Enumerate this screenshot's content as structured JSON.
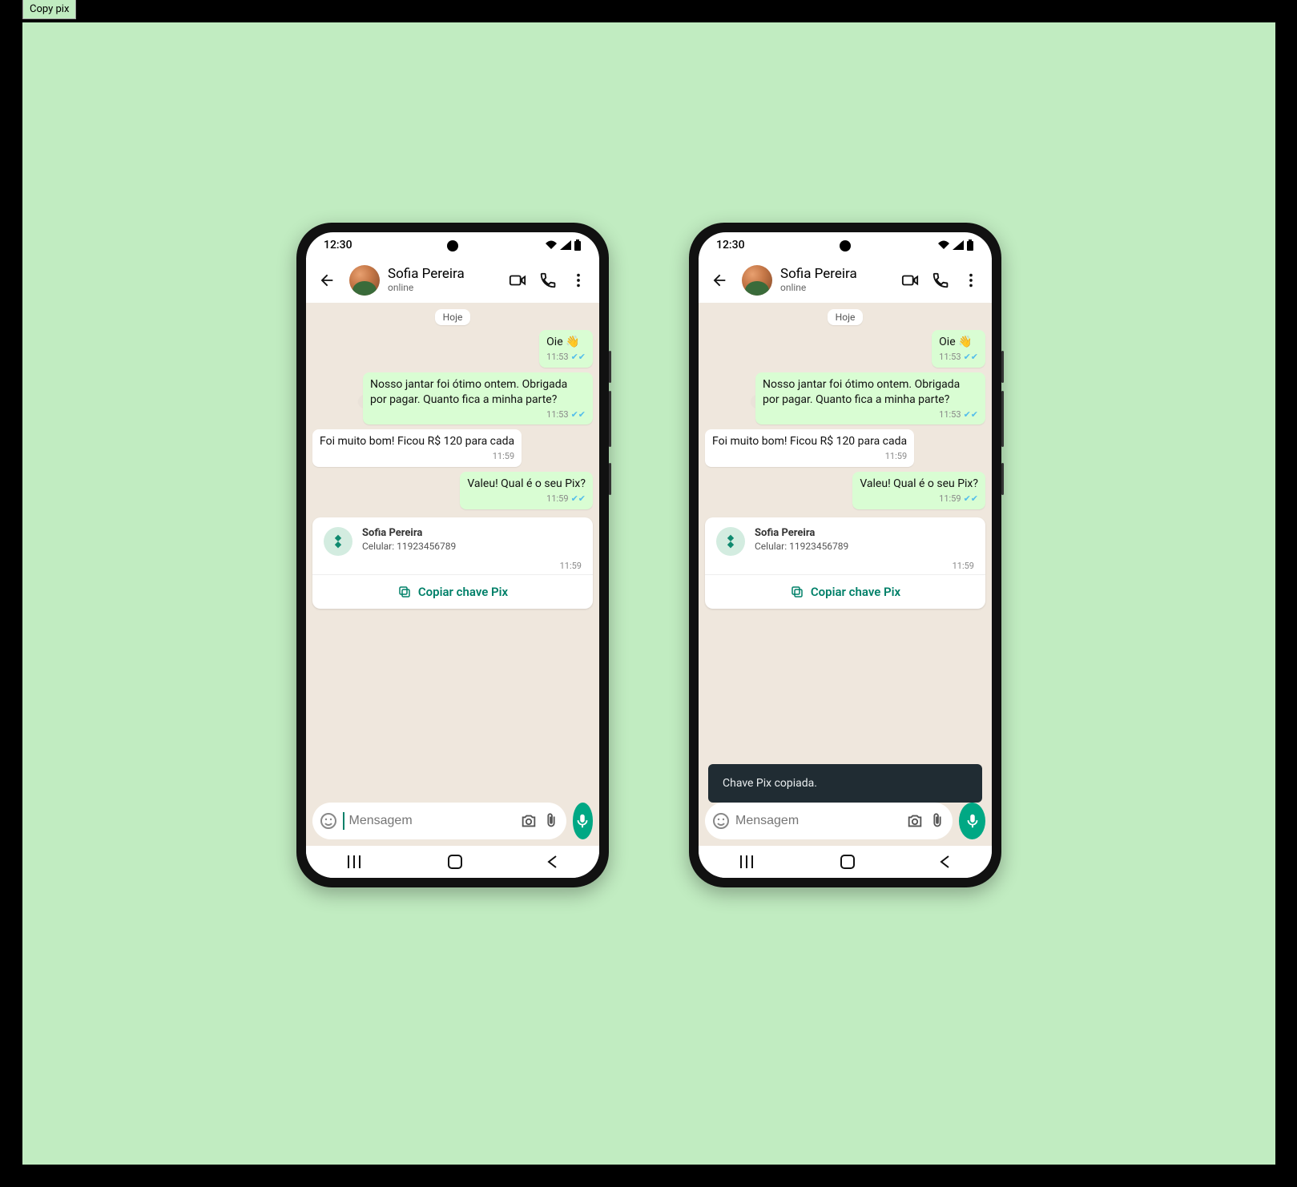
{
  "tab": {
    "label": "Copy pix"
  },
  "status": {
    "time": "12:30"
  },
  "header": {
    "contact_name": "Sofia Pereira",
    "presence": "online"
  },
  "chat": {
    "date_label": "Hoje",
    "messages": [
      {
        "side": "out",
        "text": "Oie 👋",
        "time": "11:53",
        "read": true
      },
      {
        "side": "out",
        "text": "Nosso jantar foi ótimo ontem. Obrigada por pagar. Quanto fica a minha parte?",
        "time": "11:53",
        "read": true
      },
      {
        "side": "in",
        "text": "Foi muito bom! Ficou R$ 120 para cada",
        "time": "11:59"
      },
      {
        "side": "out",
        "text": "Valeu! Qual é o seu Pix?",
        "time": "11:59",
        "read": true
      }
    ],
    "pix_card": {
      "name": "Sofia Pereira",
      "key_label": "Celular: 11923456789",
      "time": "11:59",
      "action_label": "Copiar chave Pix"
    }
  },
  "composer": {
    "placeholder": "Mensagem"
  },
  "toast": {
    "text": "Chave Pix copiada."
  }
}
